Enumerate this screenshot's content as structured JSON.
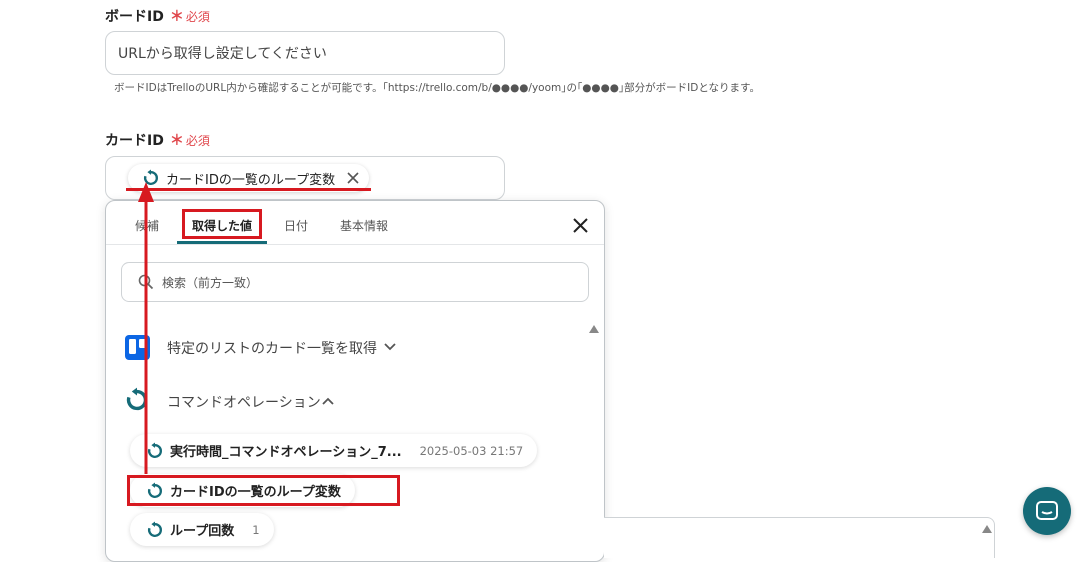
{
  "board_field": {
    "label": "ボードID",
    "required_mark": "＊",
    "required_text": "必須",
    "placeholder": "URLから取得し設定してください",
    "hint": "ボードIDはTrelloのURL内から確認することが可能です。｢https://trello.com/b/●●●●/yoom｣の｢●●●●｣部分がボードIDとなります。"
  },
  "card_field": {
    "label": "カードID",
    "required_mark": "＊",
    "required_text": "必須",
    "chip_label": "カードIDの一覧のループ変数",
    "chip_remove_icon": "close-icon"
  },
  "dropdown": {
    "tabs": [
      {
        "label": "候補",
        "active": false
      },
      {
        "label": "取得した値",
        "active": true
      },
      {
        "label": "日付",
        "active": false
      },
      {
        "label": "基本情報",
        "active": false
      }
    ],
    "close_icon": "close-icon",
    "search": {
      "placeholder": "検索（前方一致）",
      "icon": "search-icon"
    },
    "groups": [
      {
        "title": "特定のリストのカード一覧を取得",
        "icon": "trello-icon",
        "expanded": false
      },
      {
        "title": "コマンドオペレーション",
        "icon": "loop-icon",
        "expanded": true
      }
    ],
    "items": [
      {
        "label": "実行時間_コマンドオペレーション_7...",
        "meta": "2025-05-03 21:57"
      },
      {
        "label": "カードIDの一覧のループ変数",
        "meta": ""
      },
      {
        "label": "ループ回数",
        "meta": "1"
      }
    ]
  },
  "colors": {
    "accent_teal": "#156b78",
    "required_red": "#e0474c",
    "annotation_red": "#d71920",
    "trello_blue": "#0c66e4"
  },
  "help_button": {
    "icon": "chat-icon"
  }
}
